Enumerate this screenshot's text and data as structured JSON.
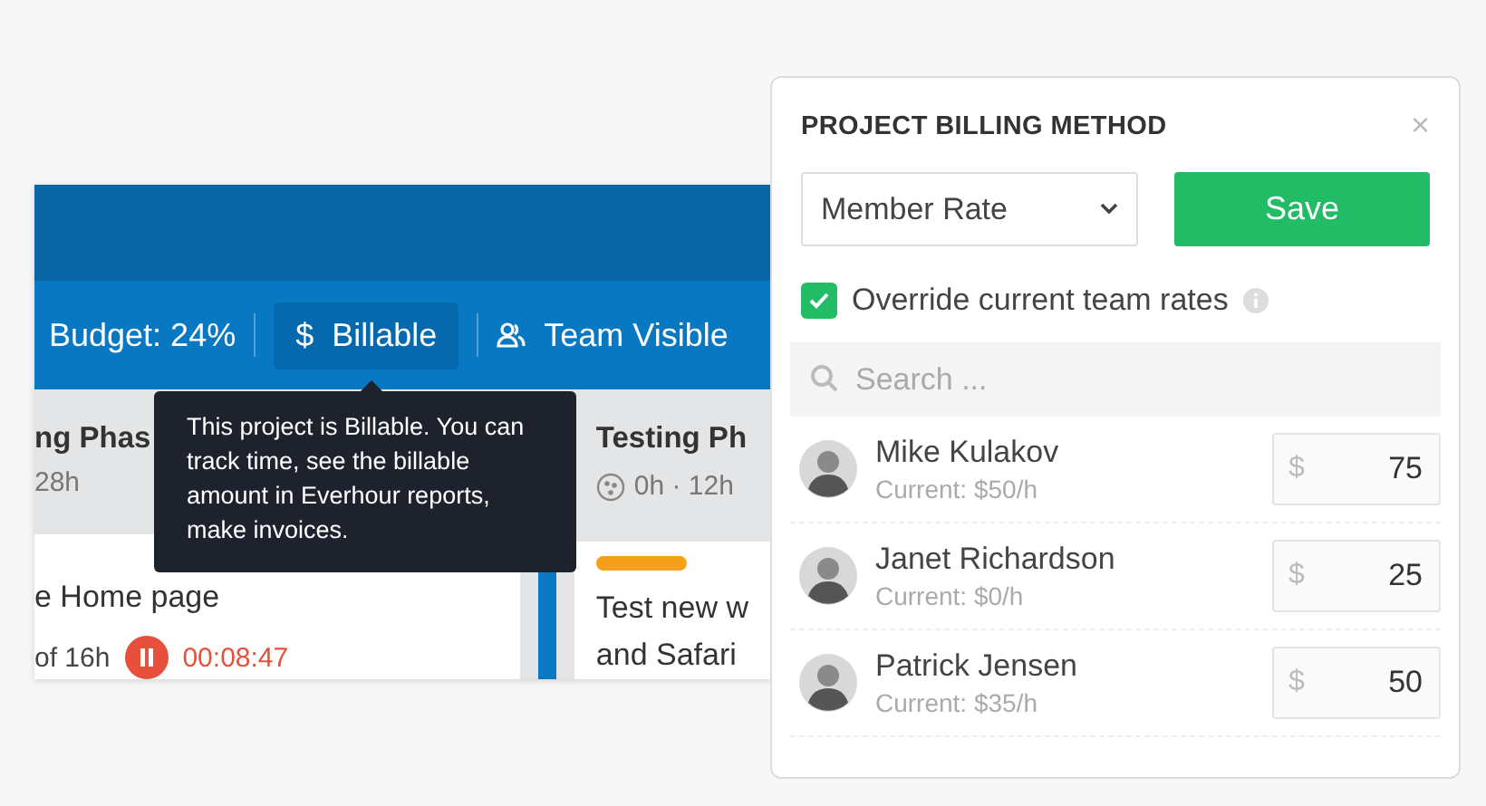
{
  "board": {
    "toolbar": {
      "budget": "Budget: 24%",
      "billable": {
        "icon": "$",
        "label": "Billable",
        "selected": true
      },
      "visibility": "Team Visible"
    },
    "columns": [
      {
        "title": "ng Phas",
        "estimate": "28h",
        "card": {
          "title": "e Home page",
          "progress": "of 16h",
          "running": true,
          "timer": "00:08:47"
        }
      },
      {
        "title": "Testing Ph",
        "estimate": "0h · 12h",
        "card": {
          "title": "Test new w",
          "subtitle": "and Safari",
          "color": "#f6a01a"
        }
      }
    ],
    "tooltip": "This project is Billable. You can track time, see the billable amount in Everhour reports, make invoices."
  },
  "panel": {
    "title": "PROJECT BILLING METHOD",
    "close": "×",
    "method": "Member Rate",
    "save": "Save",
    "override": {
      "label": "Override current team rates",
      "checked": true
    },
    "search": {
      "placeholder": "Search ..."
    },
    "members": [
      {
        "name": "Mike Kulakov",
        "current": "Current: $50/h",
        "currency": "$",
        "rate": "75"
      },
      {
        "name": "Janet Richardson",
        "current": "Current: $0/h",
        "currency": "$",
        "rate": "25"
      },
      {
        "name": "Patrick Jensen",
        "current": "Current: $35/h",
        "currency": "$",
        "rate": "50"
      }
    ]
  }
}
